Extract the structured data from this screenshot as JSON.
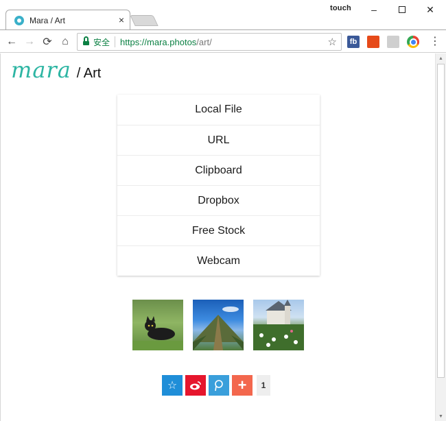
{
  "window": {
    "user_label": "touch",
    "minimize_label": "–",
    "close_label": "✕"
  },
  "tab": {
    "title": "Mara / Art",
    "close_label": "×"
  },
  "toolbar": {
    "back_label": "←",
    "forward_label": "→",
    "reload_label": "⟳",
    "home_label": "⌂",
    "secure_label": "安全",
    "url_main": "https://mara.photos",
    "url_rest": "/art/",
    "star_label": "☆",
    "ext_fb_label": "fb",
    "menu_label": "⋮"
  },
  "page": {
    "logo_word": "mara",
    "section_title": "/ Art",
    "sources": [
      {
        "label": "Local File"
      },
      {
        "label": "URL"
      },
      {
        "label": "Clipboard"
      },
      {
        "label": "Dropbox"
      },
      {
        "label": "Free Stock"
      },
      {
        "label": "Webcam"
      }
    ],
    "share": {
      "count": "1",
      "more_label": "+"
    }
  },
  "colors": {
    "logo": "#2db5a3",
    "secure": "#0b8043",
    "qzone": "#1f8ed8",
    "weibo": "#e6162d",
    "tqq": "#3a9fdb",
    "more": "#f3674d"
  }
}
